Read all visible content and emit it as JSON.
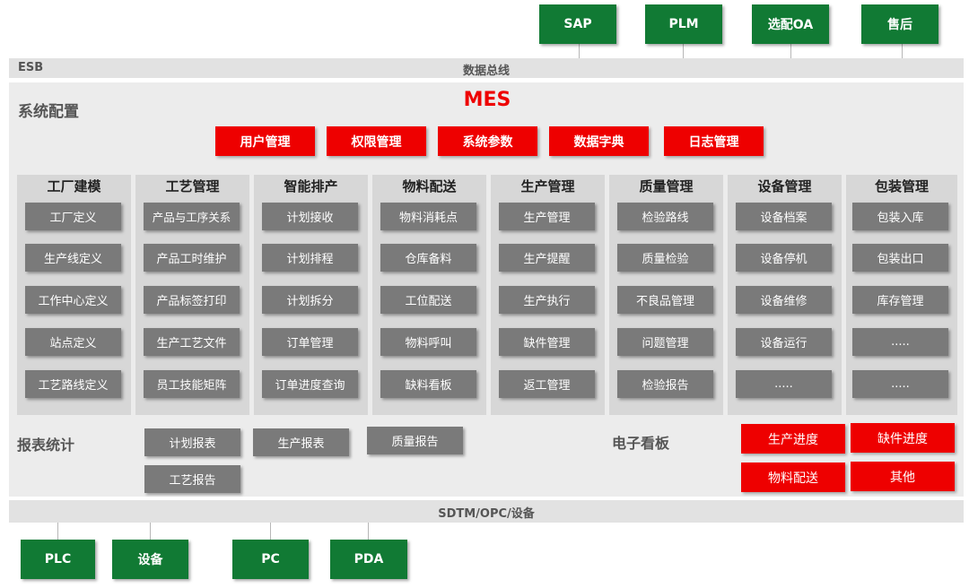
{
  "top_systems": [
    "SAP",
    "PLM",
    "选配OA",
    "售后"
  ],
  "esb": {
    "left_label": "ESB",
    "center_label": "数据总线"
  },
  "system_config": {
    "label": "系统配置",
    "title": "MES"
  },
  "config_buttons": [
    "用户管理",
    "权限管理",
    "系统参数",
    "数据字典",
    "日志管理"
  ],
  "modules": [
    {
      "title": "工厂建模",
      "items": [
        "工厂定义",
        "生产线定义",
        "工作中心定义",
        "站点定义",
        "工艺路线定义"
      ]
    },
    {
      "title": "工艺管理",
      "items": [
        "产品与工序关系",
        "产品工时维护",
        "产品标签打印",
        "生产工艺文件",
        "员工技能矩阵"
      ]
    },
    {
      "title": "智能排产",
      "items": [
        "计划接收",
        "计划排程",
        "计划拆分",
        "订单管理",
        "订单进度查询"
      ]
    },
    {
      "title": "物料配送",
      "items": [
        "物料消耗点",
        "仓库备料",
        "工位配送",
        "物料呼叫",
        "缺料看板"
      ]
    },
    {
      "title": "生产管理",
      "items": [
        "生产管理",
        "生产提醒",
        "生产执行",
        "缺件管理",
        "返工管理"
      ]
    },
    {
      "title": "质量管理",
      "items": [
        "检验路线",
        "质量检验",
        "不良品管理",
        "问题管理",
        "检验报告"
      ]
    },
    {
      "title": "设备管理",
      "items": [
        "设备档案",
        "设备停机",
        "设备维修",
        "设备运行",
        "....."
      ]
    },
    {
      "title": "包装管理",
      "items": [
        "包装入库",
        "包装出口",
        "库存管理",
        ".....",
        "....."
      ]
    }
  ],
  "reports": {
    "label": "报表统计",
    "items": [
      "计划报表",
      "生产报表",
      "质量报告",
      "工艺报告"
    ]
  },
  "kanban": {
    "label": "电子看板",
    "items": [
      "生产进度",
      "缺件进度",
      "物料配送",
      "其他"
    ]
  },
  "bottom_bus": {
    "label": "SDTM/OPC/设备"
  },
  "bottom_devices": [
    "PLC",
    "设备",
    "PC",
    "PDA"
  ]
}
